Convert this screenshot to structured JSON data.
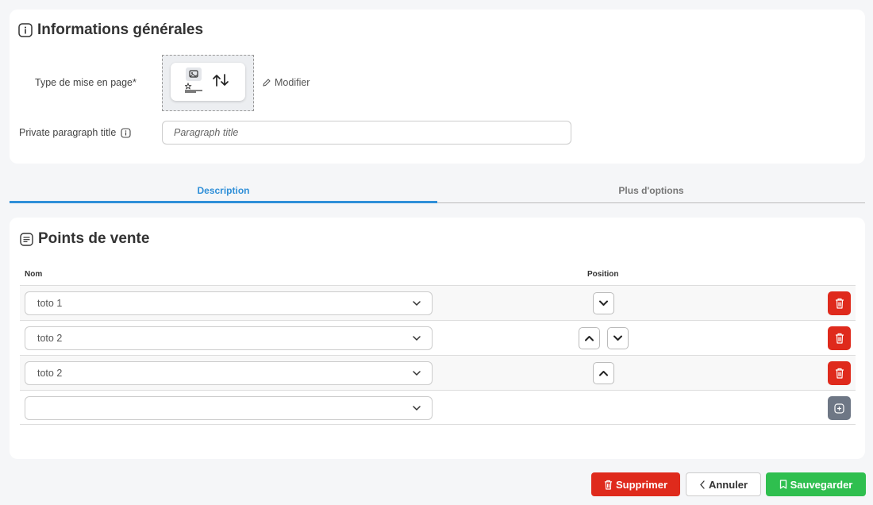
{
  "general": {
    "title": "Informations générales",
    "layout_label": "Type de mise en page*",
    "modify_label": "Modifier",
    "private_title_label": "Private paragraph title",
    "private_title_placeholder": "Paragraph title",
    "private_title_value": ""
  },
  "tabs": [
    {
      "label": "Description",
      "active": true
    },
    {
      "label": "Plus d'options",
      "active": false
    }
  ],
  "points": {
    "title": "Points de vente",
    "col_name": "Nom",
    "col_position": "Position",
    "rows": [
      {
        "value": "toto 1",
        "can_up": false,
        "can_down": true
      },
      {
        "value": "toto 2",
        "can_up": true,
        "can_down": true
      },
      {
        "value": "toto 2",
        "can_up": true,
        "can_down": false
      },
      {
        "value": "",
        "is_new": true
      }
    ]
  },
  "footer": {
    "delete_label": "Supprimer",
    "cancel_label": "Annuler",
    "save_label": "Sauvegarder"
  },
  "colors": {
    "accent": "#2f8fd8",
    "danger": "#df2a1c",
    "success": "#2fbf4f",
    "neutral": "#6e7785"
  },
  "icons": {
    "info": "info-icon",
    "layout_image": "image-icon",
    "layout_arrows": "sort-arrows-icon",
    "modify": "pencil-icon",
    "list": "list-icon",
    "select": "chevron-down-icon",
    "move_up": "chevron-up-icon",
    "move_down": "chevron-down-icon",
    "delete": "trash-icon",
    "add": "plus-square-icon",
    "cancel": "chevron-left-icon",
    "save": "bookmark-icon"
  }
}
